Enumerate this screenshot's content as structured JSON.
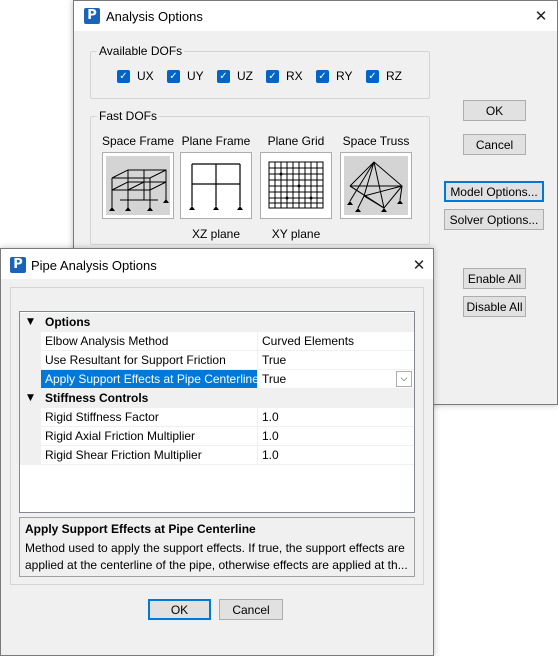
{
  "analysis_options": {
    "title": "Analysis Options",
    "close": "✕",
    "available_dofs": {
      "legend": "Available DOFs",
      "items": [
        {
          "label": "UX",
          "checked": true
        },
        {
          "label": "UY",
          "checked": true
        },
        {
          "label": "UZ",
          "checked": true
        },
        {
          "label": "RX",
          "checked": true
        },
        {
          "label": "RY",
          "checked": true
        },
        {
          "label": "RZ",
          "checked": true
        }
      ]
    },
    "fast_dofs": {
      "legend": "Fast DOFs",
      "items": [
        {
          "label": "Space Frame",
          "sublabel": "",
          "icon": "space-frame-icon"
        },
        {
          "label": "Plane Frame",
          "sublabel": "XZ plane",
          "icon": "plane-frame-icon"
        },
        {
          "label": "Plane Grid",
          "sublabel": "XY plane",
          "icon": "plane-grid-icon"
        },
        {
          "label": "Space Truss",
          "sublabel": "",
          "icon": "space-truss-icon"
        }
      ]
    },
    "buttons": {
      "ok": "OK",
      "cancel": "Cancel",
      "model_options": "Model Options...",
      "solver_options": "Solver Options...",
      "enable_all": "Enable All",
      "disable_all": "Disable All"
    }
  },
  "pipe_options": {
    "title": "Pipe Analysis Options",
    "close": "✕",
    "grid": {
      "categories": [
        {
          "label": "Options",
          "expanded": true,
          "rows": [
            {
              "name": "Elbow Analysis Method",
              "value": "Curved Elements",
              "selected": false
            },
            {
              "name": "Use Resultant for Support Friction",
              "value": "True",
              "selected": false
            },
            {
              "name": "Apply Support Effects at Pipe Centerline",
              "value": "True",
              "selected": true
            }
          ]
        },
        {
          "label": "Stiffness Controls",
          "expanded": true,
          "rows": [
            {
              "name": "Rigid Stiffness Factor",
              "value": "1.0",
              "selected": false
            },
            {
              "name": "Rigid Axial Friction Multiplier",
              "value": "1.0",
              "selected": false
            },
            {
              "name": "Rigid Shear Friction Multiplier",
              "value": "1.0",
              "selected": false
            }
          ]
        }
      ]
    },
    "description": {
      "title": "Apply Support Effects at Pipe Centerline",
      "text": "Method used to apply the support effects. If true, the support effects are applied at the centerline of the pipe, otherwise effects are applied at th..."
    },
    "buttons": {
      "ok": "OK",
      "cancel": "Cancel"
    }
  },
  "colors": {
    "accent": "#0078d7",
    "app_icon": "#1b63b8",
    "checkbox": "#0065c8"
  }
}
